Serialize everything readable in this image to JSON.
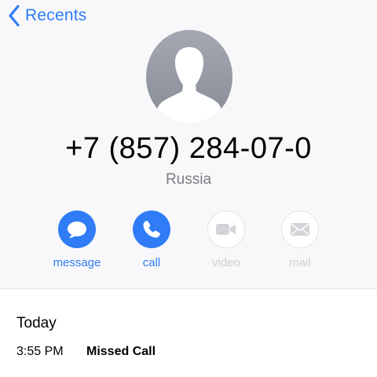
{
  "nav": {
    "back_label": "Recents"
  },
  "contact": {
    "number": "+7 (857) 284-07-0",
    "country": "Russia"
  },
  "actions": [
    {
      "label": "message",
      "icon": "message-icon",
      "enabled": true
    },
    {
      "label": "call",
      "icon": "phone-icon",
      "enabled": true
    },
    {
      "label": "video",
      "icon": "video-icon",
      "enabled": false
    },
    {
      "label": "mail",
      "icon": "mail-icon",
      "enabled": false
    }
  ],
  "history": {
    "section_title": "Today",
    "entries": [
      {
        "time": "3:55 PM",
        "type": "Missed Call"
      }
    ]
  },
  "colors": {
    "accent": "#2f7cf6",
    "disabled": "#cfcfd3",
    "secondary_text": "#7d7d82",
    "header_background": "#f8f8fa"
  }
}
